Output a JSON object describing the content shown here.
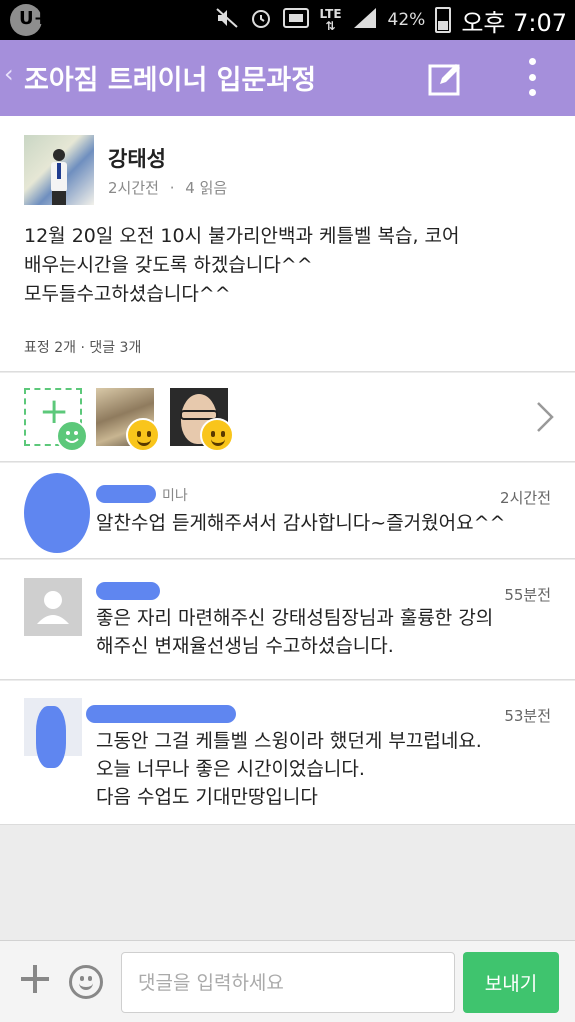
{
  "status_bar": {
    "carrier_logo": "U+",
    "lte_label": "LTE",
    "battery": "42%",
    "time": "오후 7:07",
    "icons": [
      "mute-icon",
      "alarm-icon",
      "nfc-icon",
      "lte-icon",
      "signal-icon",
      "battery-icon"
    ]
  },
  "header": {
    "back_symbol": "‹",
    "title": "조아짐 트레이너 입문과정",
    "background": "#a58fdb"
  },
  "post": {
    "author": "강태성",
    "time": "2시간전",
    "separator": "·",
    "reads": "4 읽음",
    "body_lines": [
      "12월 20일 오전 10시 불가리안백과 케틀벨 복습, 코어",
      "배우는시간을 갖도록 하겠습니다^^",
      "모두들수고하셨습니다^^"
    ],
    "stats": "표정 2개 · 댓글 3개"
  },
  "reactions": {
    "items": [
      "reactor-photo-1",
      "reactor-photo-2"
    ]
  },
  "comments": [
    {
      "name_suffix": "미나",
      "time": "2시간전",
      "lines": [
        "알찬수업 듣게해주셔서 감사합니다~즐거웠어요^^"
      ]
    },
    {
      "time": "55분전",
      "lines": [
        "좋은 자리 마련해주신 강태성팀장님과 훌륭한 강의",
        "해주신 변재율선생님 수고하셨습니다."
      ]
    },
    {
      "time": "53분전",
      "lines": [
        "그동안 그걸 케틀벨 스윙이라 했던게 부끄럽네요.",
        "오늘 너무나 좋은 시간이었습니다.",
        "다음 수업도 기대만땅입니다"
      ]
    }
  ],
  "composer": {
    "placeholder": "댓글을 입력하세요",
    "send_label": "보내기",
    "accent": "#3fc46e"
  }
}
